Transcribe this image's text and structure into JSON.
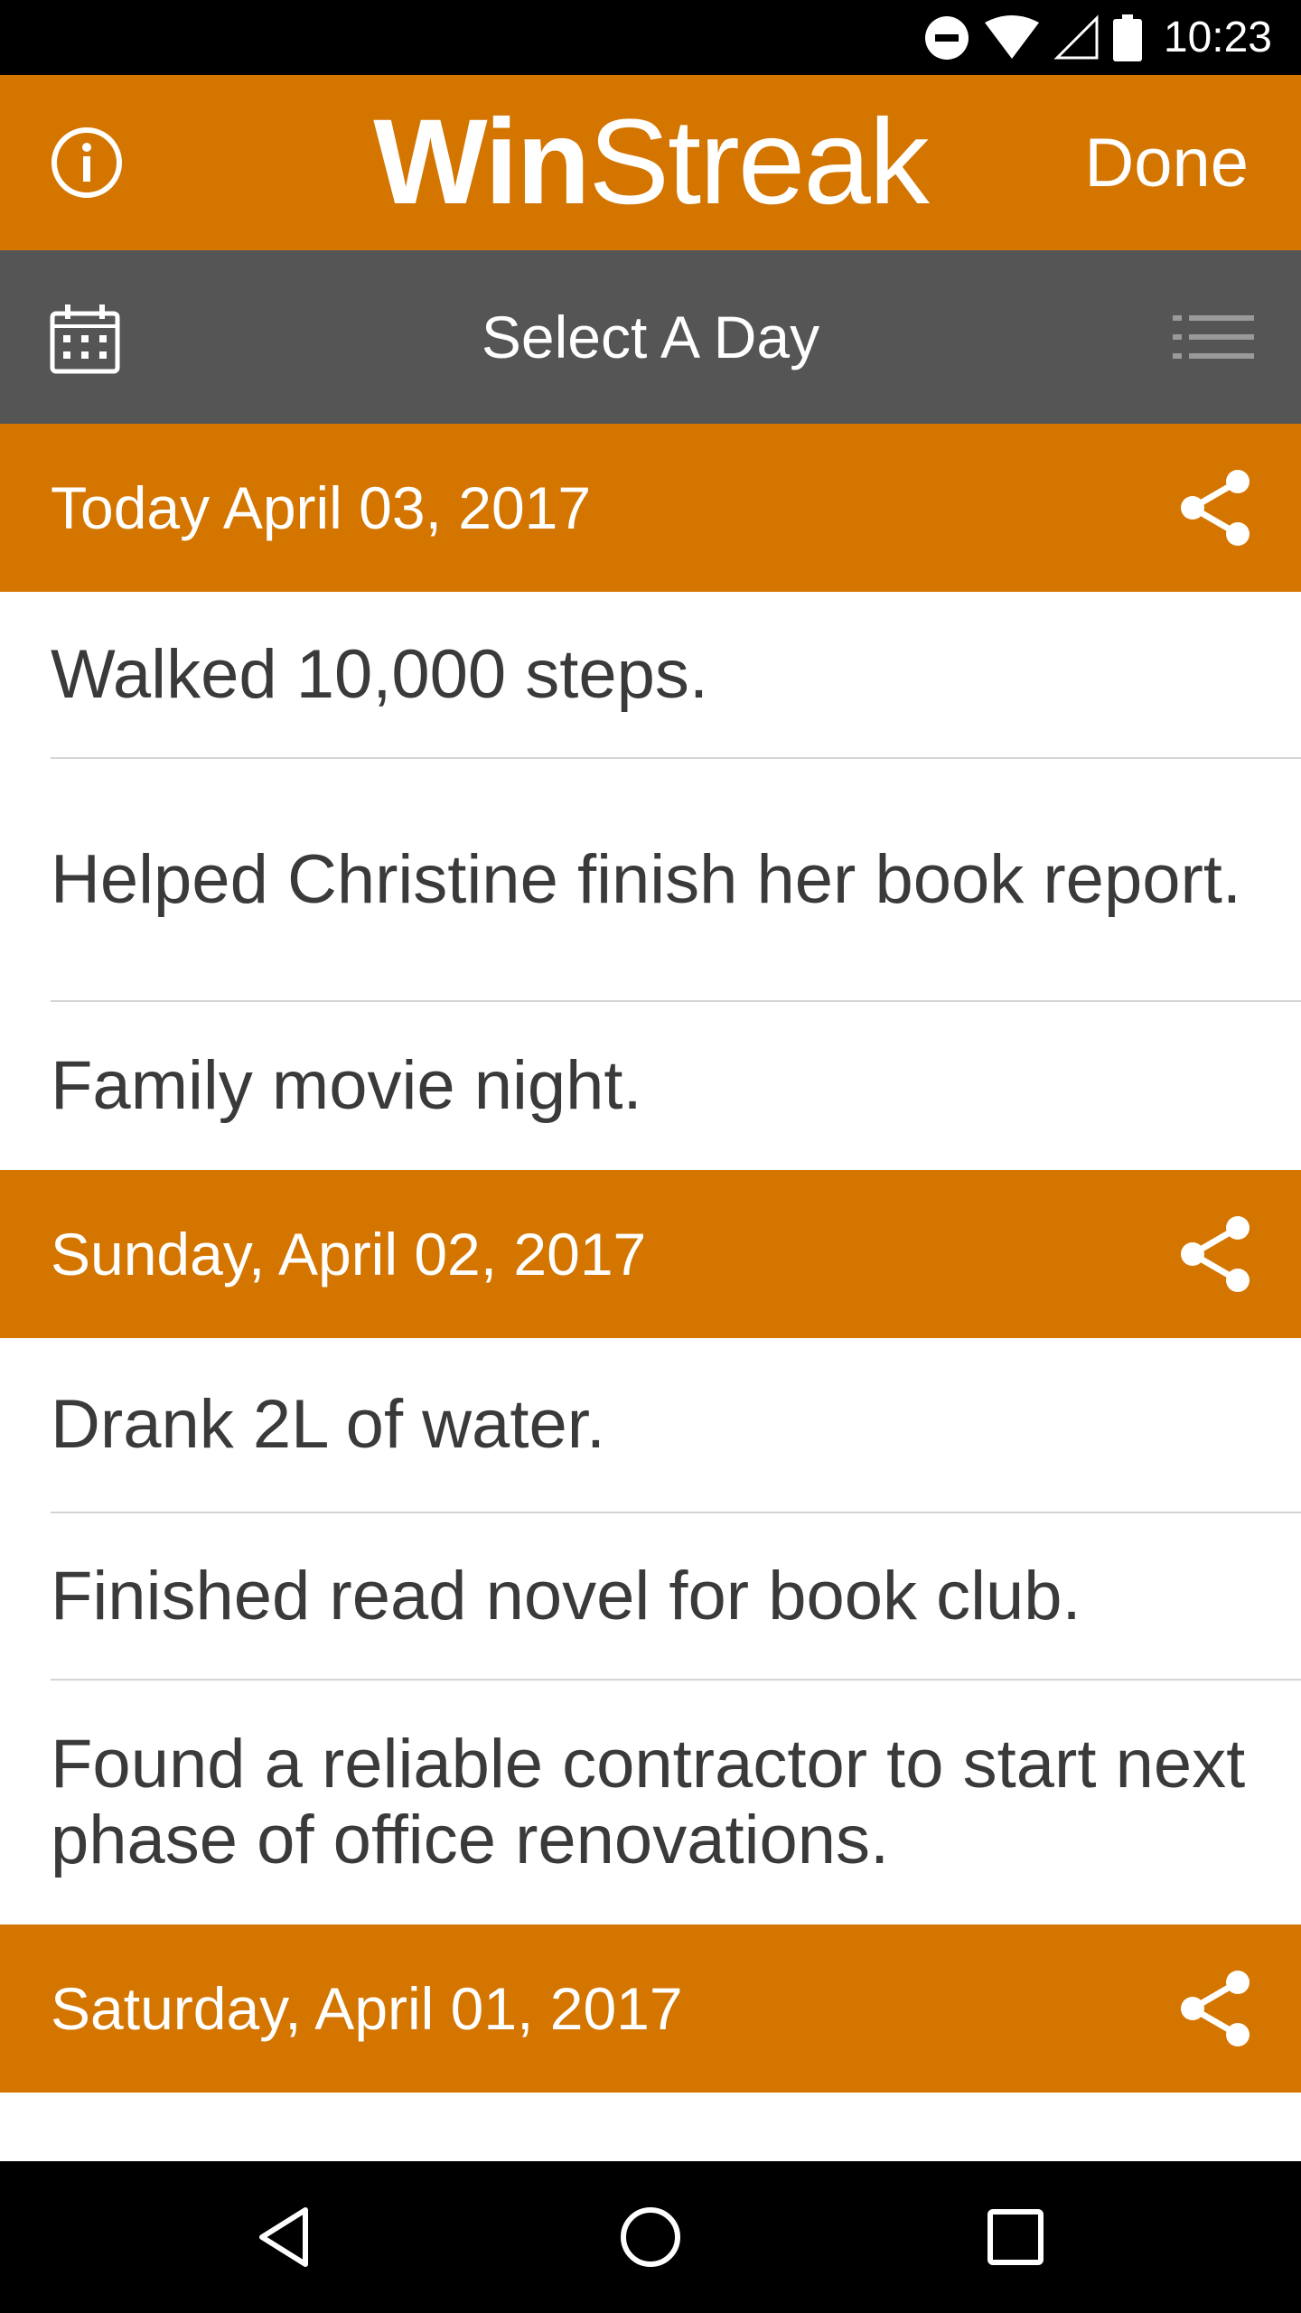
{
  "status_bar": {
    "time": "10:23",
    "icons": [
      "do-not-disturb-icon",
      "wifi-icon",
      "signal-icon",
      "battery-icon"
    ]
  },
  "header": {
    "logo_bold": "Win",
    "logo_light": "Streak",
    "done_label": "Done",
    "info_icon": "info-icon",
    "color": "#d47500"
  },
  "toolbar": {
    "title": "Select A Day",
    "calendar_icon": "calendar-icon",
    "list_icon": "list-icon",
    "color": "#555555"
  },
  "days": [
    {
      "date": "Today April 03, 2017",
      "entries": [
        "Walked 10,000 steps.",
        "Helped Christine finish her book report.",
        "Family movie night."
      ]
    },
    {
      "date": "Sunday, April 02, 2017",
      "entries": [
        "Drank 2L of water.",
        "Finished read novel for book club.",
        "Found a reliable contractor to start next phase of office renovations."
      ]
    },
    {
      "date": "Saturday, April 01, 2017",
      "entries": []
    }
  ],
  "nav_bar": {
    "icons": [
      "back-icon",
      "home-icon",
      "recents-icon"
    ]
  }
}
